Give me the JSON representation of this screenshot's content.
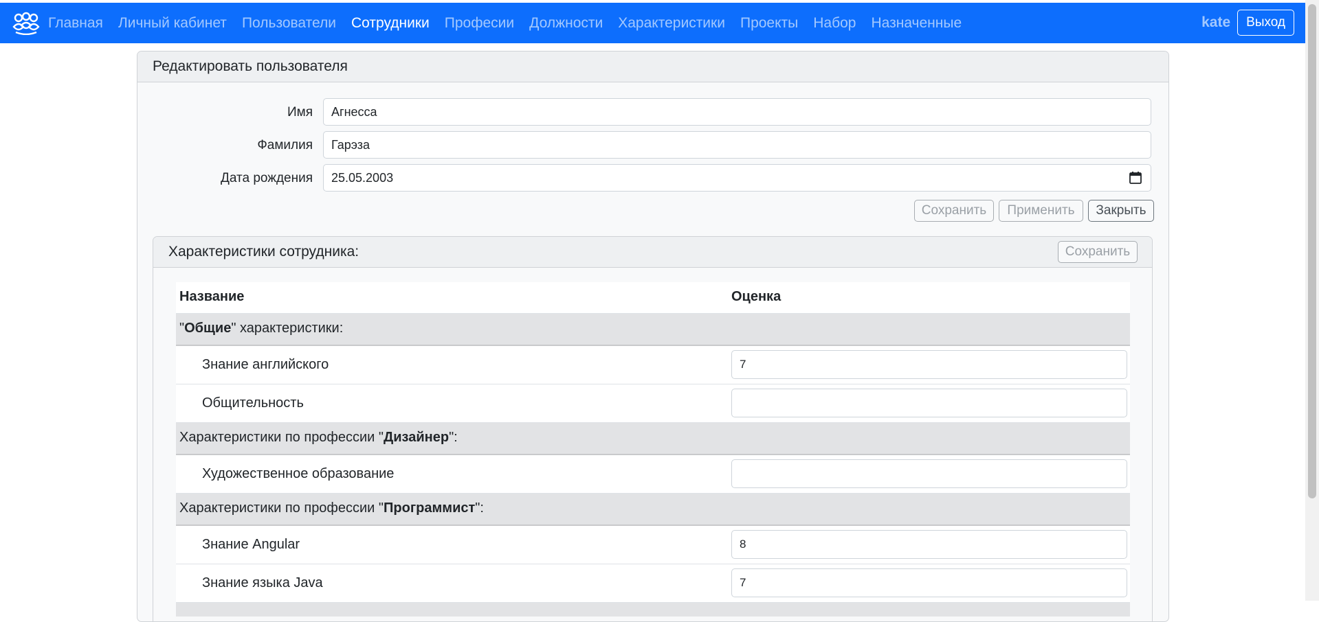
{
  "nav": {
    "items": [
      "Главная",
      "Личный кабинет",
      "Пользователи",
      "Сотрудники",
      "Професии",
      "Должности",
      "Характеристики",
      "Проекты",
      "Набор",
      "Назначенные"
    ],
    "active": "Сотрудники",
    "user": "kate",
    "logout": "Выход"
  },
  "form": {
    "title": "Редактировать пользователя",
    "first_name_label": "Имя",
    "first_name_value": "Агнесса",
    "last_name_label": "Фамилия",
    "last_name_value": "Гарэза",
    "birth_label": "Дата рождения",
    "birth_value": "25.05.2003",
    "save": "Сохранить",
    "apply": "Применить",
    "close": "Закрыть"
  },
  "traits": {
    "title": "Характеристики сотрудника:",
    "save": "Сохранить",
    "col_name": "Название",
    "col_score": "Оценка",
    "groups": [
      {
        "prefix": "\"",
        "bold": "Общие",
        "suffix": "\" характеристики:",
        "items": [
          {
            "name": "Знание английского",
            "score": "7"
          },
          {
            "name": "Общительность",
            "score": ""
          }
        ]
      },
      {
        "prefix": "Характеристики по профессии \"",
        "bold": "Дизайнер",
        "suffix": "\":",
        "items": [
          {
            "name": "Художественное образование",
            "score": ""
          }
        ]
      },
      {
        "prefix": "Характеристики по профессии \"",
        "bold": "Программист",
        "suffix": "\":",
        "items": [
          {
            "name": "Знание Angular",
            "score": "8"
          },
          {
            "name": "Знание языка Java",
            "score": "7"
          }
        ]
      }
    ]
  },
  "colors": {
    "navbar": "#0d6efd",
    "group_bg": "#e2e3e5"
  }
}
